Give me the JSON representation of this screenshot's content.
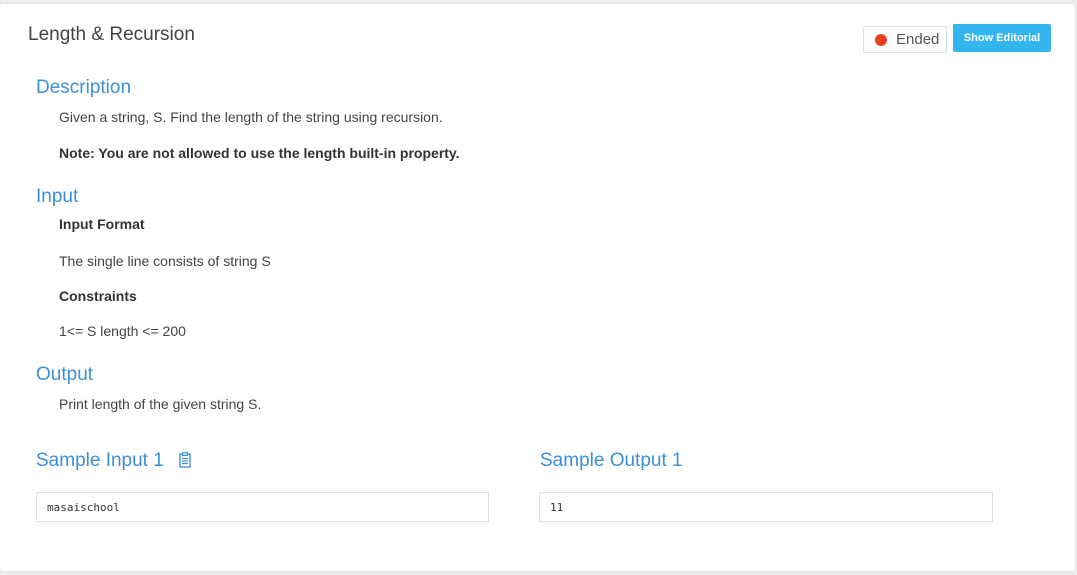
{
  "problem": {
    "title": "Length & Recursion",
    "status_label": "Ended",
    "status_color": "#e8401c",
    "editorial_button": "Show Editorial"
  },
  "description": {
    "heading": "Description",
    "text": "Given a string, S. Find the length of the string using recursion.",
    "note": "Note: You are not allowed to use the length built-in property."
  },
  "input": {
    "heading": "Input",
    "format_label": "Input Format",
    "format_text": "The single line  consists of string S",
    "constraints_label": "Constraints",
    "constraints_text": "1<= S length <= 200"
  },
  "output": {
    "heading": "Output",
    "text": "Print length of the given string S."
  },
  "samples": {
    "input_heading": "Sample Input 1",
    "input_value": "masaischool",
    "output_heading": "Sample Output 1",
    "output_value": "11",
    "copy_icon": "clipboard-icon"
  },
  "colors": {
    "accent": "#3d8fd6",
    "button": "#33b5f0"
  }
}
